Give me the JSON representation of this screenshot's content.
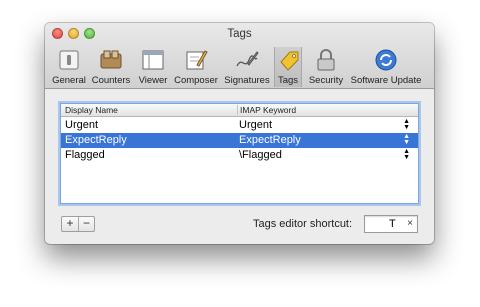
{
  "window": {
    "title": "Tags"
  },
  "toolbar": {
    "items": [
      {
        "label": "General",
        "icon": "general-switch-icon"
      },
      {
        "label": "Counters",
        "icon": "counters-icon"
      },
      {
        "label": "Viewer",
        "icon": "viewer-window-icon"
      },
      {
        "label": "Composer",
        "icon": "composer-icon"
      },
      {
        "label": "Signatures",
        "icon": "signature-pen-icon"
      },
      {
        "label": "Tags",
        "icon": "tag-icon",
        "selected": true
      },
      {
        "label": "Security",
        "icon": "lock-icon"
      },
      {
        "label": "Software Update",
        "icon": "software-update-icon"
      }
    ]
  },
  "table": {
    "columns": [
      "Display Name",
      "IMAP Keyword"
    ],
    "rows": [
      {
        "name": "Urgent",
        "keyword": "Urgent"
      },
      {
        "name": "ExpectReply",
        "keyword": "ExpectReply",
        "selected": true
      },
      {
        "name": "Flagged",
        "keyword": "\\Flagged"
      }
    ]
  },
  "controls": {
    "add_label": "+",
    "remove_label": "−",
    "shortcut_label": "Tags editor shortcut:",
    "shortcut_value": "T",
    "clear_label": "×"
  },
  "colors": {
    "selection": "#3875d7",
    "focus_ring": "#7ea6de"
  }
}
